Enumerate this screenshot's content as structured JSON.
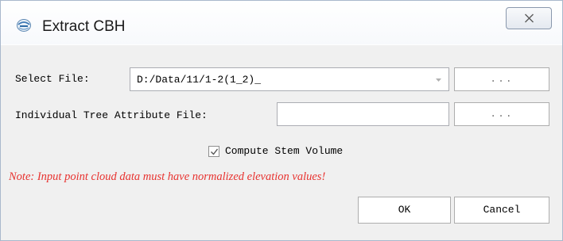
{
  "window": {
    "title": "Extract CBH",
    "icon": "app-logo-icon",
    "close_icon": "close-icon"
  },
  "form": {
    "select_file_label": "Select File:",
    "select_file_value": "D:/Data/11/1-2(1_2)_",
    "select_file_dropdown_icon": "chevron-down-icon",
    "browse_label": "...",
    "attribute_file_label": "Individual Tree Attribute File:",
    "attribute_file_value": "",
    "attribute_browse_label": "...",
    "compute_stem_volume_label": "Compute Stem Volume",
    "compute_stem_volume_checked": true,
    "note": "Note: Input point cloud data must have normalized elevation values!"
  },
  "buttons": {
    "ok_label": "OK",
    "cancel_label": "Cancel"
  },
  "colors": {
    "note_text": "#e8322f",
    "dialog_background": "#f0f0f0",
    "border": "#a9b8cc"
  }
}
